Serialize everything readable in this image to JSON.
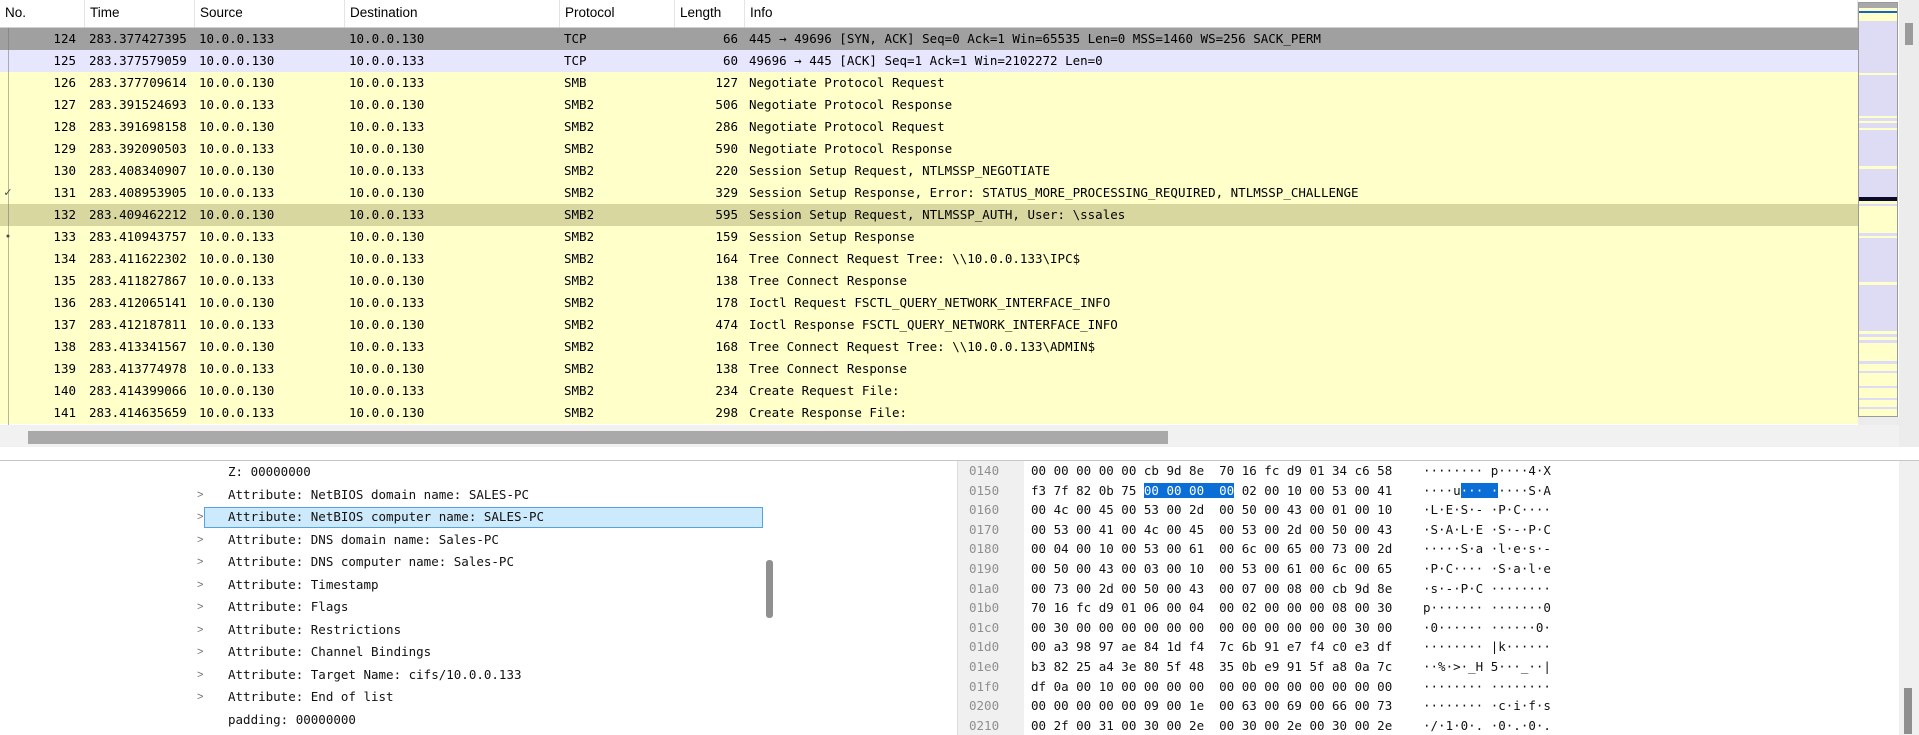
{
  "colors": {
    "row_gray": "#a0a0a0",
    "row_tcp": "#e7e6ff",
    "row_smb": "#ffffc9",
    "row_selected": "#d9d7a0",
    "tree_sel_bg": "#cde9fc",
    "tree_sel_border": "#55a3e0",
    "hex_highlight": "#0a6ed6",
    "offset_text": "#8f8f8f"
  },
  "icons": {
    "tree_chevron": ">",
    "mark_check": "✓",
    "mark_dot": "●"
  },
  "packet_list": {
    "columns": [
      {
        "label": "No."
      },
      {
        "label": "Time"
      },
      {
        "label": "Source"
      },
      {
        "label": "Destination"
      },
      {
        "label": "Protocol"
      },
      {
        "label": "Length"
      },
      {
        "label": "Info"
      }
    ],
    "rows": [
      {
        "no": "124",
        "time": "283.377427395",
        "src": "10.0.0.133",
        "dst": "10.0.0.130",
        "proto": "TCP",
        "len": "66",
        "info": "445 → 49696 [SYN, ACK] Seq=0 Ack=1 Win=65535 Len=0 MSS=1460 WS=256 SACK_PERM",
        "color": "gray",
        "mark": ""
      },
      {
        "no": "125",
        "time": "283.377579059",
        "src": "10.0.0.130",
        "dst": "10.0.0.133",
        "proto": "TCP",
        "len": "60",
        "info": "49696 → 445 [ACK] Seq=1 Ack=1 Win=2102272 Len=0",
        "color": "tcp",
        "mark": ""
      },
      {
        "no": "126",
        "time": "283.377709614",
        "src": "10.0.0.130",
        "dst": "10.0.0.133",
        "proto": "SMB",
        "len": "127",
        "info": "Negotiate Protocol Request",
        "color": "smb",
        "mark": ""
      },
      {
        "no": "127",
        "time": "283.391524693",
        "src": "10.0.0.133",
        "dst": "10.0.0.130",
        "proto": "SMB2",
        "len": "506",
        "info": "Negotiate Protocol Response",
        "color": "smb",
        "mark": ""
      },
      {
        "no": "128",
        "time": "283.391698158",
        "src": "10.0.0.130",
        "dst": "10.0.0.133",
        "proto": "SMB2",
        "len": "286",
        "info": "Negotiate Protocol Request",
        "color": "smb",
        "mark": ""
      },
      {
        "no": "129",
        "time": "283.392090503",
        "src": "10.0.0.133",
        "dst": "10.0.0.130",
        "proto": "SMB2",
        "len": "590",
        "info": "Negotiate Protocol Response",
        "color": "smb",
        "mark": ""
      },
      {
        "no": "130",
        "time": "283.408340907",
        "src": "10.0.0.130",
        "dst": "10.0.0.133",
        "proto": "SMB2",
        "len": "220",
        "info": "Session Setup Request, NTLMSSP_NEGOTIATE",
        "color": "smb",
        "mark": ""
      },
      {
        "no": "131",
        "time": "283.408953905",
        "src": "10.0.0.133",
        "dst": "10.0.0.130",
        "proto": "SMB2",
        "len": "329",
        "info": "Session Setup Response, Error: STATUS_MORE_PROCESSING_REQUIRED, NTLMSSP_CHALLENGE",
        "color": "smb",
        "mark": "check"
      },
      {
        "no": "132",
        "time": "283.409462212",
        "src": "10.0.0.130",
        "dst": "10.0.0.133",
        "proto": "SMB2",
        "len": "595",
        "info": "Session Setup Request, NTLMSSP_AUTH, User: \\ssales",
        "color": "sel",
        "mark": ""
      },
      {
        "no": "133",
        "time": "283.410943757",
        "src": "10.0.0.133",
        "dst": "10.0.0.130",
        "proto": "SMB2",
        "len": "159",
        "info": "Session Setup Response",
        "color": "smb",
        "mark": "dot"
      },
      {
        "no": "134",
        "time": "283.411622302",
        "src": "10.0.0.130",
        "dst": "10.0.0.133",
        "proto": "SMB2",
        "len": "164",
        "info": "Tree Connect Request Tree: \\\\10.0.0.133\\IPC$",
        "color": "smb",
        "mark": ""
      },
      {
        "no": "135",
        "time": "283.411827867",
        "src": "10.0.0.133",
        "dst": "10.0.0.130",
        "proto": "SMB2",
        "len": "138",
        "info": "Tree Connect Response",
        "color": "smb",
        "mark": ""
      },
      {
        "no": "136",
        "time": "283.412065141",
        "src": "10.0.0.130",
        "dst": "10.0.0.133",
        "proto": "SMB2",
        "len": "178",
        "info": "Ioctl Request FSCTL_QUERY_NETWORK_INTERFACE_INFO",
        "color": "smb",
        "mark": ""
      },
      {
        "no": "137",
        "time": "283.412187811",
        "src": "10.0.0.133",
        "dst": "10.0.0.130",
        "proto": "SMB2",
        "len": "474",
        "info": "Ioctl Response FSCTL_QUERY_NETWORK_INTERFACE_INFO",
        "color": "smb",
        "mark": ""
      },
      {
        "no": "138",
        "time": "283.413341567",
        "src": "10.0.0.130",
        "dst": "10.0.0.133",
        "proto": "SMB2",
        "len": "168",
        "info": "Tree Connect Request Tree: \\\\10.0.0.133\\ADMIN$",
        "color": "smb",
        "mark": ""
      },
      {
        "no": "139",
        "time": "283.413774978",
        "src": "10.0.0.133",
        "dst": "10.0.0.130",
        "proto": "SMB2",
        "len": "138",
        "info": "Tree Connect Response",
        "color": "smb",
        "mark": ""
      },
      {
        "no": "140",
        "time": "283.414399066",
        "src": "10.0.0.130",
        "dst": "10.0.0.133",
        "proto": "SMB2",
        "len": "234",
        "info": "Create Request File:",
        "color": "smb",
        "mark": ""
      },
      {
        "no": "141",
        "time": "283.414635659",
        "src": "10.0.0.133",
        "dst": "10.0.0.130",
        "proto": "SMB2",
        "len": "298",
        "info": "Create Response File:",
        "color": "smb",
        "mark": ""
      }
    ]
  },
  "detail_pane": {
    "rows": [
      {
        "text": "Z: 00000000",
        "chevron": false,
        "selected": false
      },
      {
        "text": "Attribute: NetBIOS domain name: SALES-PC",
        "chevron": true,
        "selected": false
      },
      {
        "text": "Attribute: NetBIOS computer name: SALES-PC",
        "chevron": true,
        "selected": true
      },
      {
        "text": "Attribute: DNS domain name: Sales-PC",
        "chevron": true,
        "selected": false
      },
      {
        "text": "Attribute: DNS computer name: Sales-PC",
        "chevron": true,
        "selected": false
      },
      {
        "text": "Attribute: Timestamp",
        "chevron": true,
        "selected": false
      },
      {
        "text": "Attribute: Flags",
        "chevron": true,
        "selected": false
      },
      {
        "text": "Attribute: Restrictions",
        "chevron": true,
        "selected": false
      },
      {
        "text": "Attribute: Channel Bindings",
        "chevron": true,
        "selected": false
      },
      {
        "text": "Attribute: Target Name: cifs/10.0.0.133",
        "chevron": true,
        "selected": false
      },
      {
        "text": "Attribute: End of list",
        "chevron": true,
        "selected": false
      },
      {
        "text": "padding: 00000000",
        "chevron": false,
        "selected": false
      }
    ]
  },
  "hex_pane": {
    "rows": [
      {
        "offset": "0140",
        "hex": "00 00 00 00 00 cb 9d 8e  70 16 fc d9 01 34 c6 58",
        "ascii": "········ p····4·X"
      },
      {
        "offset": "0150",
        "hex_pre": "f3 7f 82 0b 75 ",
        "hex_hl": "00 00 00  00",
        "hex_post": " 02 00 10 00 53 00 41",
        "ascii_pre": "····u",
        "ascii_hl": "··· ·",
        "ascii_post": "····S·A"
      },
      {
        "offset": "0160",
        "hex": "00 4c 00 45 00 53 00 2d  00 50 00 43 00 01 00 10",
        "ascii": "·L·E·S·- ·P·C····"
      },
      {
        "offset": "0170",
        "hex": "00 53 00 41 00 4c 00 45  00 53 00 2d 00 50 00 43",
        "ascii": "·S·A·L·E ·S·-·P·C"
      },
      {
        "offset": "0180",
        "hex": "00 04 00 10 00 53 00 61  00 6c 00 65 00 73 00 2d",
        "ascii": "·····S·a ·l·e·s·-"
      },
      {
        "offset": "0190",
        "hex": "00 50 00 43 00 03 00 10  00 53 00 61 00 6c 00 65",
        "ascii": "·P·C···· ·S·a·l·e"
      },
      {
        "offset": "01a0",
        "hex": "00 73 00 2d 00 50 00 43  00 07 00 08 00 cb 9d 8e",
        "ascii": "·s·-·P·C ········"
      },
      {
        "offset": "01b0",
        "hex": "70 16 fc d9 01 06 00 04  00 02 00 00 00 08 00 30",
        "ascii": "p······· ·······0"
      },
      {
        "offset": "01c0",
        "hex": "00 30 00 00 00 00 00 00  00 00 00 00 00 00 30 00",
        "ascii": "·0······ ······0·"
      },
      {
        "offset": "01d0",
        "hex": "00 a3 98 97 ae 84 1d f4  7c 6b 91 e7 f4 c0 e3 df",
        "ascii": "········ |k······"
      },
      {
        "offset": "01e0",
        "hex": "b3 82 25 a4 3e 80 5f 48  35 0b e9 91 5f a8 0a 7c",
        "ascii": "··%·>·_H 5···_··|"
      },
      {
        "offset": "01f0",
        "hex": "df 0a 00 10 00 00 00 00  00 00 00 00 00 00 00 00",
        "ascii": "········ ········"
      },
      {
        "offset": "0200",
        "hex": "00 00 00 00 00 09 00 1e  00 63 00 69 00 66 00 73",
        "ascii": "········ ·c·i·f·s"
      },
      {
        "offset": "0210",
        "hex": "00 2f 00 31 00 30 00 2e  00 30 00 2e 00 30 00 2e",
        "ascii": "·/·1·0·. ·0·.·0·."
      }
    ]
  }
}
